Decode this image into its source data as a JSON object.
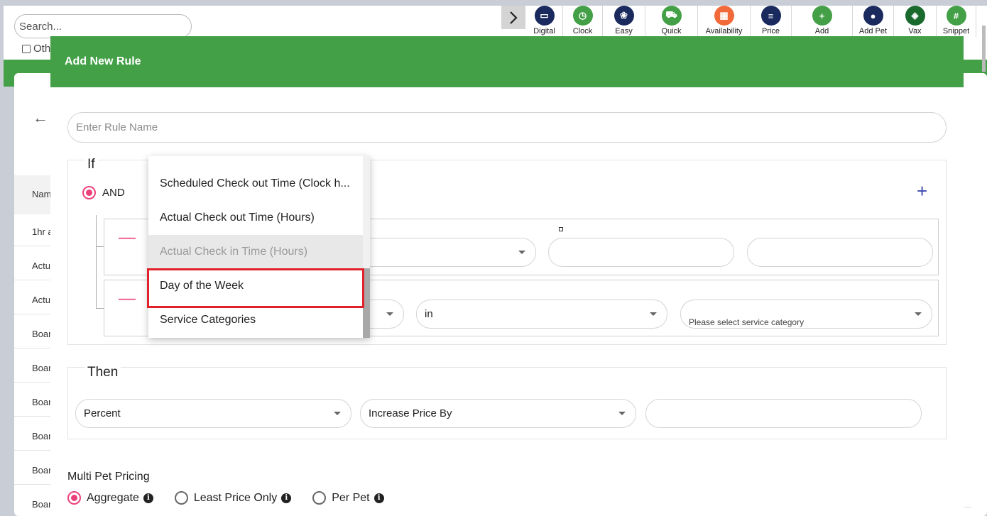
{
  "background": {
    "search_placeholder": "Search...",
    "other_label": "Oth",
    "toolbar": [
      {
        "label": "Digital",
        "icon": "monitor-icon",
        "color": "#1a2a5e",
        "width": 52
      },
      {
        "label": "Clock",
        "icon": "clock-icon",
        "color": "#43a047",
        "width": 56
      },
      {
        "label": "Easy",
        "icon": "paw-icon",
        "color": "#1a2a5e",
        "width": 60
      },
      {
        "label": "Quick",
        "icon": "cart-icon",
        "color": "#43a047",
        "width": 74
      },
      {
        "label": "Availability",
        "icon": "calendar-icon",
        "color": "#f26a3a",
        "width": 74
      },
      {
        "label": "Price",
        "icon": "document-icon",
        "color": "#1a2a5e",
        "width": 58
      },
      {
        "label": "Add",
        "icon": "add-square-icon",
        "color": "#43a047",
        "width": 86
      },
      {
        "label": "Add Pet",
        "icon": "user-add-icon",
        "color": "#1a2a5e",
        "width": 58
      },
      {
        "label": "Vax",
        "icon": "shield-icon",
        "color": "#1a6a2e",
        "width": 60
      },
      {
        "label": "Snippet",
        "icon": "hash-icon",
        "color": "#43a047",
        "width": 56
      }
    ],
    "table_header": "Nam",
    "rows": [
      "1hr a",
      "Actu",
      "Actu",
      "Boar",
      "Boar",
      "Boar",
      "Boar",
      "Boar",
      "Boar"
    ]
  },
  "modal": {
    "title": "Add New Rule",
    "rule_name_placeholder": "Enter Rule Name",
    "if_legend": "If",
    "and_label": "AND",
    "condition2": {
      "operator": "in",
      "value_placeholder": "Please select service category"
    },
    "then_legend": "Then",
    "then": {
      "type": "Percent",
      "action": "Increase Price By",
      "amount": ""
    },
    "multi_pet": {
      "title": "Multi Pet Pricing",
      "options": [
        {
          "label": "Aggregate",
          "selected": true
        },
        {
          "label": "Least Price Only",
          "selected": false
        },
        {
          "label": "Per Pet",
          "selected": false
        }
      ]
    }
  },
  "dropdown": {
    "items": [
      {
        "label": "Scheduled Check out Time (Clock h...",
        "state": "normal"
      },
      {
        "label": "Actual Check out Time (Hours)",
        "state": "normal"
      },
      {
        "label": "Actual Check in Time (Hours)",
        "state": "disabled"
      },
      {
        "label": "Day of the Week",
        "state": "highlighted"
      },
      {
        "label": "Service Categories",
        "state": "normal"
      }
    ],
    "highlight_color": "#e0202a"
  },
  "colors": {
    "primary_green": "#43a047",
    "accent_pink": "#ec407a",
    "plus_blue": "#3949ab"
  }
}
